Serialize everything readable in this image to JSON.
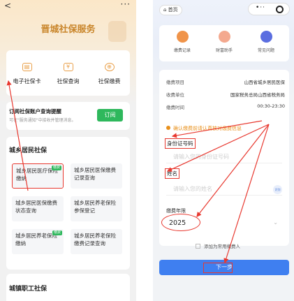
{
  "left": {
    "nav_back": "<",
    "nav_more": "···",
    "title": "晋城社保服务",
    "services": [
      {
        "label": "电子社保卡",
        "icon": "card-icon",
        "glyph": "▤"
      },
      {
        "label": "社保查询",
        "icon": "yuan-shield-icon",
        "glyph": "¥"
      },
      {
        "label": "社保缴费",
        "icon": "coin-icon",
        "glyph": "⊕"
      }
    ],
    "subscribe": {
      "title": "订阅社保账户查询提醒",
      "subtitle": "可在\"服务通知\"中接收并管理消息。",
      "button": "订阅"
    },
    "urban_rural": {
      "heading": "城乡居民社保",
      "tiles": [
        {
          "label": "城乡居民医疗保险缴纳",
          "badge": "缴费"
        },
        {
          "label": "城乡居民医保缴费记录查询",
          "badge": ""
        },
        {
          "label": "城乡居民医保缴费状态查询",
          "badge": ""
        },
        {
          "label": "城乡居民养老保险参保登记",
          "badge": ""
        },
        {
          "label": "城乡居民养老保险缴纳",
          "badge": "缴费"
        },
        {
          "label": "城乡居民养老保险缴费记录查询",
          "badge": ""
        }
      ]
    },
    "employee": {
      "heading": "城镇职工社保"
    }
  },
  "right": {
    "home": "⌂ 首页",
    "capsule_dots": "•··",
    "quick": [
      {
        "label": "缴费记录",
        "color": "#f0944a"
      },
      {
        "label": "财富助手",
        "color": "#f4a98f"
      },
      {
        "label": "常见问题",
        "color": "#5b6ee0"
      }
    ],
    "info_rows": [
      {
        "label": "缴费项目",
        "value": "山西省城乡居民医保"
      },
      {
        "label": "收费单位",
        "value": "国家税务总局山西省税务局"
      },
      {
        "label": "缴费时间",
        "value": "00:30-23:30"
      }
    ],
    "notice": "确认缴费前请认真核对缴费信息",
    "id_label": "身份证号码",
    "id_placeholder": "请输入您的身份证号码",
    "name_label": "姓名",
    "name_placeholder": "请输入您的姓名",
    "scan_label": "识别",
    "year_label": "缴费年限",
    "year_value": "2025",
    "chevron": "⌄",
    "add_common": "添加为常用缴费人",
    "next_button": "下一步"
  },
  "colors": {
    "accent_gold": "#c9852a",
    "green": "#2eb85c",
    "blue": "#3f7ff0",
    "annotation_red": "#e8382f",
    "notice_orange": "#e8901b"
  }
}
